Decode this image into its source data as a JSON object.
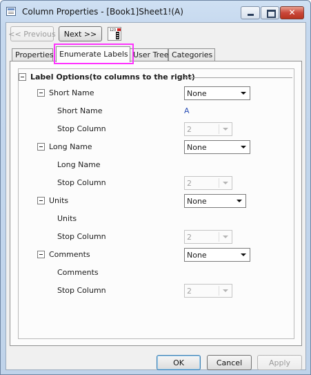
{
  "window": {
    "title": "Column Properties - [Book1]Sheet1!(A)"
  },
  "nav": {
    "previous_label": "<< Previous",
    "next_label": "Next >>",
    "tool_icon_text": "123"
  },
  "tabs": [
    {
      "label": "Properties",
      "active": false
    },
    {
      "label": "Enumerate Labels",
      "active": true
    },
    {
      "label": "User Tree",
      "active": false
    },
    {
      "label": "Categories",
      "active": false
    }
  ],
  "label_options": {
    "group_title": "Label Options(to columns to the right)",
    "sections": [
      {
        "name": "Short Name",
        "select": "None",
        "value_label": "Short Name",
        "value": "A",
        "stop_label": "Stop Column",
        "stop_value": "2"
      },
      {
        "name": "Long Name",
        "select": "None",
        "value_label": "Long Name",
        "value": "",
        "stop_label": "Stop Column",
        "stop_value": "2"
      },
      {
        "name": "Units",
        "select": "None",
        "value_label": "Units",
        "value": "",
        "stop_label": "Stop Column",
        "stop_value": "2"
      },
      {
        "name": "Comments",
        "select": "None",
        "value_label": "Comments",
        "value": "",
        "stop_label": "Stop Column",
        "stop_value": "2"
      }
    ]
  },
  "footer": {
    "ok_label": "OK",
    "cancel_label": "Cancel",
    "apply_label": "Apply"
  },
  "colors": {
    "highlight": "#ff33ff",
    "value_text": "#2a4fb6",
    "close_button": "#c9473a"
  }
}
